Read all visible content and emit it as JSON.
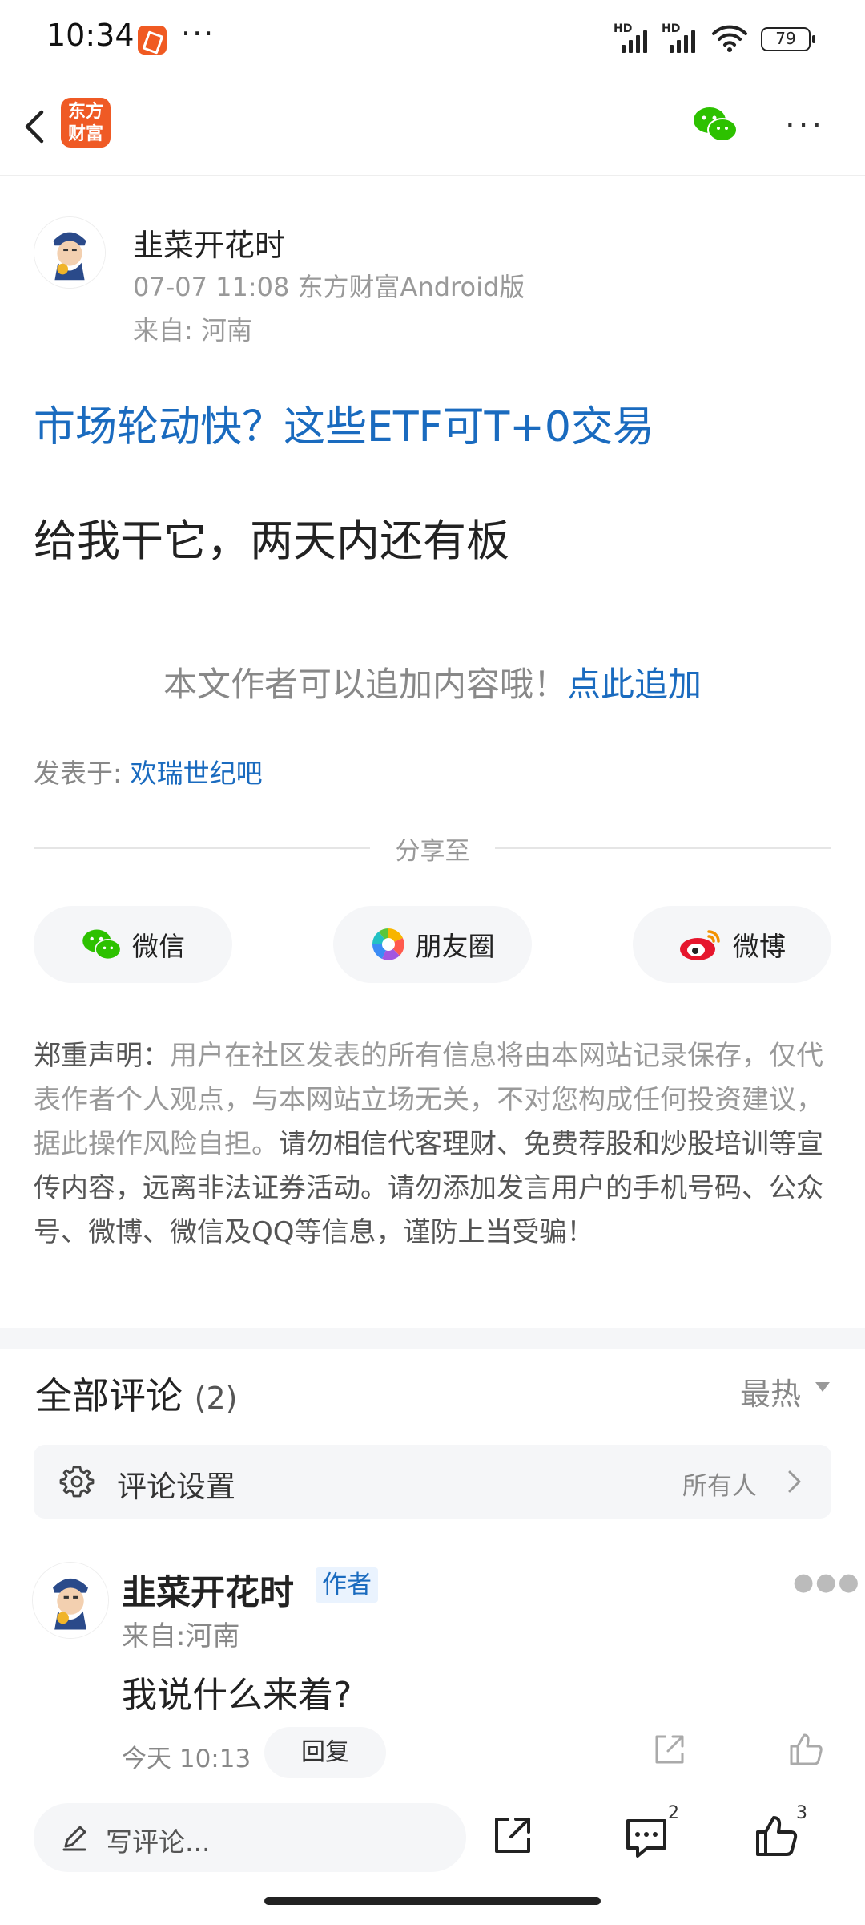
{
  "status_bar": {
    "time": "10:34",
    "more": "···",
    "signal_label_1": "HD",
    "signal_label_2": "HD",
    "battery": "79"
  },
  "nav": {
    "logo_text_line1": "东方",
    "logo_text_line2": "财富",
    "more": "···"
  },
  "post": {
    "author": "韭菜开花时",
    "meta": "07-07 11:08 东方财富Android版",
    "location": "来自: 河南",
    "topic": "市场轮动快？这些ETF可T+0交易",
    "content": "给我干它，两天内还有板",
    "append_text": "本文作者可以追加内容哦！",
    "append_link": "点此追加",
    "posted_label": "发表于: ",
    "posted_bar": "欢瑞世纪吧"
  },
  "share": {
    "title": "分享至",
    "buttons": [
      {
        "label": "微信",
        "icon": "wechat-icon"
      },
      {
        "label": "朋友圈",
        "icon": "moments-icon"
      },
      {
        "label": "微博",
        "icon": "weibo-icon"
      }
    ]
  },
  "disclaimer": {
    "lead": "郑重声明：",
    "normal": "用户在社区发表的所有信息将由本网站记录保存，仅代表作者个人观点，与本网站立场无关，不对您构成任何投资建议，据此操作风险自担。",
    "strong": "请勿相信代客理财、免费荐股和炒股培训等宣传内容，远离非法证券活动。请勿添加发言用户的手机号码、公众号、微博、微信及QQ等信息，谨防上当受骗！"
  },
  "comments": {
    "title": "全部评论",
    "count": "(2)",
    "sort": "最热",
    "settings_label": "评论设置",
    "settings_value": "所有人",
    "items": [
      {
        "author": "韭菜开花时",
        "badge": "作者",
        "location": "来自:河南",
        "text": "我说什么来着?",
        "time": "今天 10:13",
        "reply": "回复"
      }
    ]
  },
  "bottom_bar": {
    "write_placeholder": "写评论...",
    "comment_count": "2",
    "like_count": "3"
  },
  "colors": {
    "link_blue": "#1a6bbf",
    "brand_orange": "#ef5a25",
    "wechat_green": "#2dc100"
  }
}
